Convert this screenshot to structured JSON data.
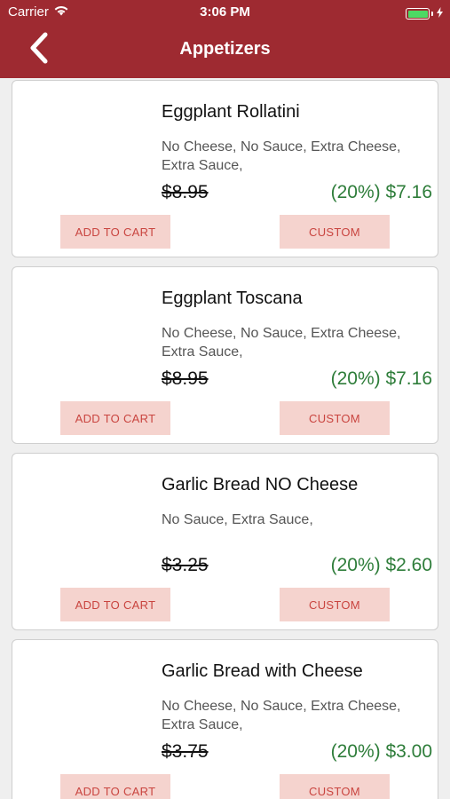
{
  "status": {
    "carrier": "Carrier",
    "time": "3:06 PM",
    "battery_level": 1.0,
    "battery_color": "#4cd964"
  },
  "nav": {
    "title": "Appetizers",
    "back_icon": "chevron-left-icon"
  },
  "colors": {
    "header_bg": "#9e2a31",
    "button_bg": "#f5d3ce",
    "button_text": "#c9443f",
    "sale_price": "#2e7d3a"
  },
  "items": [
    {
      "name": "Eggplant Rollatini",
      "options": "No Cheese, No Sauce, Extra Cheese, Extra Sauce,",
      "old_price": "$8.95",
      "new_price": "(20%) $7.16",
      "add_to_cart": "ADD TO CART",
      "custom": "CUSTOM"
    },
    {
      "name": "Eggplant Toscana",
      "options": "No Cheese, No Sauce, Extra Cheese, Extra Sauce,",
      "old_price": "$8.95",
      "new_price": "(20%) $7.16",
      "add_to_cart": "ADD TO CART",
      "custom": "CUSTOM"
    },
    {
      "name": "Garlic Bread NO Cheese",
      "options": "No Sauce, Extra Sauce,",
      "old_price": "$3.25",
      "new_price": "(20%) $2.60",
      "add_to_cart": "ADD TO CART",
      "custom": "CUSTOM"
    },
    {
      "name": "Garlic Bread with Cheese",
      "options": "No Cheese, No Sauce, Extra Cheese, Extra Sauce,",
      "old_price": "$3.75",
      "new_price": "(20%) $3.00",
      "add_to_cart": "ADD TO CART",
      "custom": "CUSTOM"
    }
  ]
}
